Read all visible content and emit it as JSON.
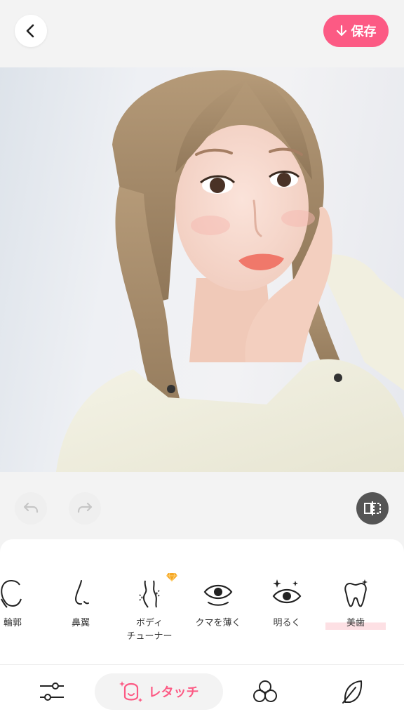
{
  "header": {
    "back_icon": "chevron-left-icon",
    "save_label": "保存",
    "save_icon": "download-arrow-icon",
    "accent_color": "#fc5a84"
  },
  "photo": {
    "subject": "selfie-portrait"
  },
  "edit_bar": {
    "undo_icon": "undo-icon",
    "redo_icon": "redo-icon",
    "compare_icon": "compare-icon"
  },
  "tools": {
    "items": [
      {
        "label": "輪郭",
        "icon": "face-contour-icon"
      },
      {
        "label": "鼻翼",
        "icon": "nose-icon"
      },
      {
        "label": "ボディ\nチューナー",
        "icon": "body-tuner-icon",
        "premium": true
      },
      {
        "label": "クマを薄く",
        "icon": "eye-icon"
      },
      {
        "label": "明るく",
        "icon": "eye-sparkle-icon"
      },
      {
        "label": "美歯",
        "icon": "tooth-icon",
        "selected": true
      }
    ]
  },
  "bottom_nav": {
    "items": [
      {
        "icon": "sliders-icon"
      },
      {
        "label": "レタッチ",
        "icon": "face-retouch-icon",
        "active": true
      },
      {
        "icon": "circles-icon"
      },
      {
        "icon": "feather-icon"
      }
    ]
  }
}
